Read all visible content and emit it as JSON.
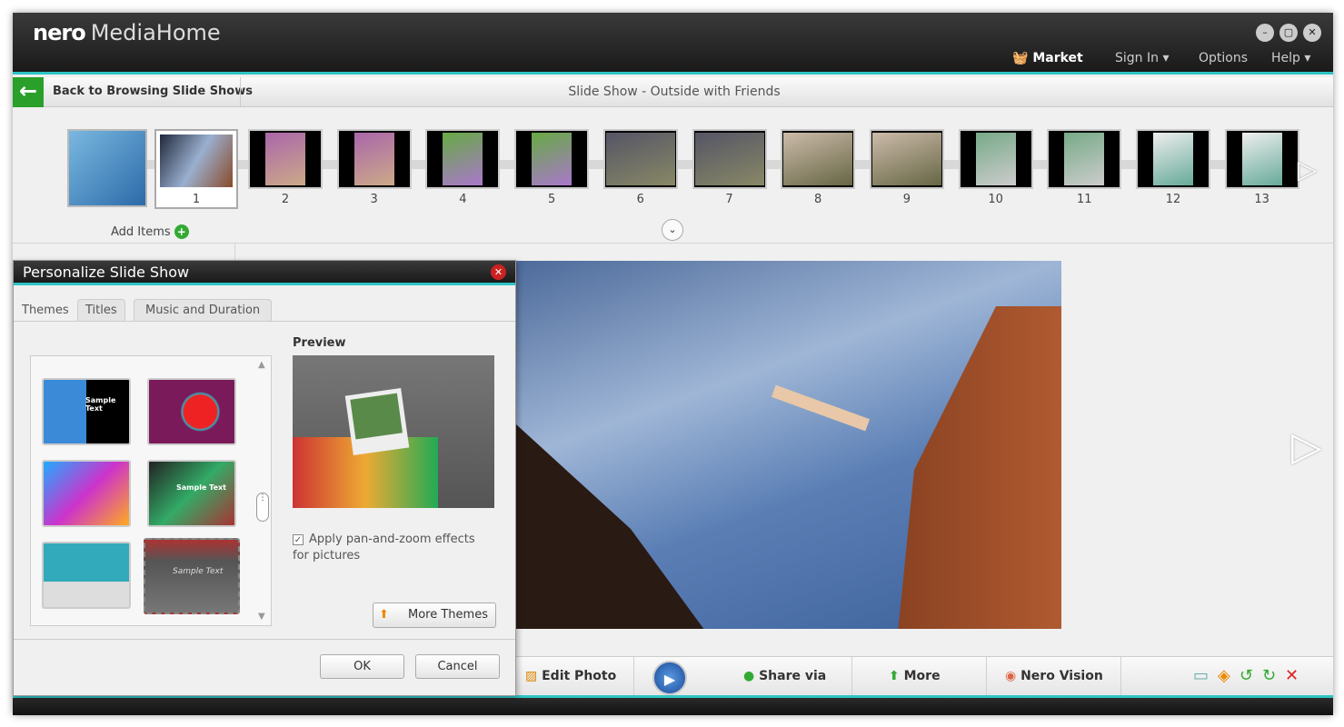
{
  "app": {
    "logo": "nero",
    "title": "MediaHome"
  },
  "menu": {
    "market": "Market",
    "sign_in": "Sign In ▾",
    "options": "Options",
    "help": "Help ▾"
  },
  "window_buttons": {
    "minimize": "–",
    "maximize": "▢",
    "close": "✕"
  },
  "nav": {
    "back": "Back to Browsing Slide Shows",
    "title": "Slide Show - Outside with Friends"
  },
  "filmstrip": {
    "items": [
      "1",
      "2",
      "3",
      "4",
      "5",
      "6",
      "7",
      "8",
      "9",
      "10",
      "11",
      "12",
      "13"
    ],
    "add_items": "Add Items"
  },
  "dialog": {
    "title": "Personalize Slide Show",
    "tabs": [
      "Themes",
      "Titles",
      "Music and Duration"
    ],
    "preview_label": "Preview",
    "theme_sample_text": "Sample Text",
    "checkbox_label": "Apply pan-and-zoom effects for pictures",
    "checkbox_checked": true,
    "more_themes": "More Themes",
    "ok": "OK",
    "cancel": "Cancel"
  },
  "toolbar": {
    "edit_photo": "Edit Photo",
    "share_via": "Share via",
    "more": "More",
    "nero_vision": "Nero Vision"
  },
  "colors": {
    "accent": "#2ec4c4",
    "back_green": "#2aa02a"
  }
}
